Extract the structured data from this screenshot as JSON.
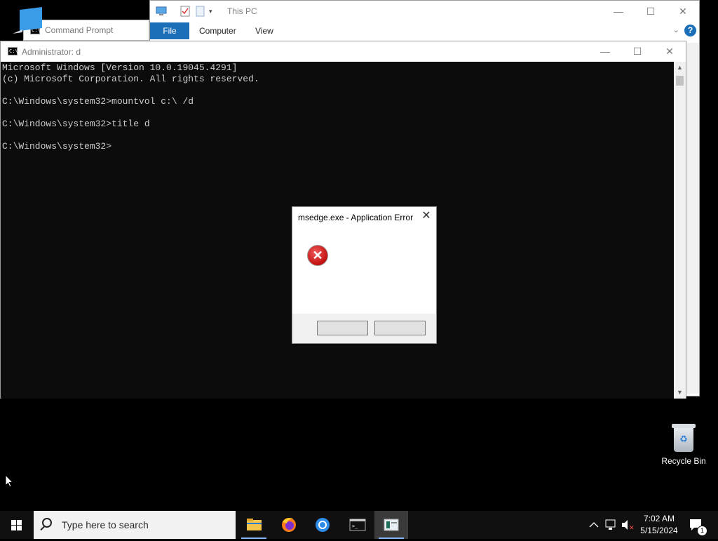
{
  "explorer": {
    "title": "This PC",
    "tabs": {
      "file": "File",
      "computer": "Computer",
      "view": "View"
    },
    "help": "?",
    "minimize": "—",
    "maximize": "☐",
    "close": "✕"
  },
  "cmd_background": {
    "title": "Command Prompt"
  },
  "console": {
    "title": "Administrator:  d",
    "lines": [
      "Microsoft Windows [Version 10.0.19045.4291]",
      "(c) Microsoft Corporation. All rights reserved.",
      "",
      "C:\\Windows\\system32>mountvol c:\\ /d",
      "",
      "C:\\Windows\\system32>title d",
      "",
      "C:\\Windows\\system32>"
    ],
    "minimize": "—",
    "maximize": "☐",
    "close": "✕"
  },
  "dialog": {
    "title": "msedge.exe - Application Error",
    "close": "✕",
    "icon": "error-icon"
  },
  "desktop": {
    "recycle_bin": "Recycle Bin"
  },
  "taskbar": {
    "search_placeholder": "Type here to search",
    "time": "7:02 AM",
    "date": "5/15/2024",
    "notification_count": "1"
  }
}
